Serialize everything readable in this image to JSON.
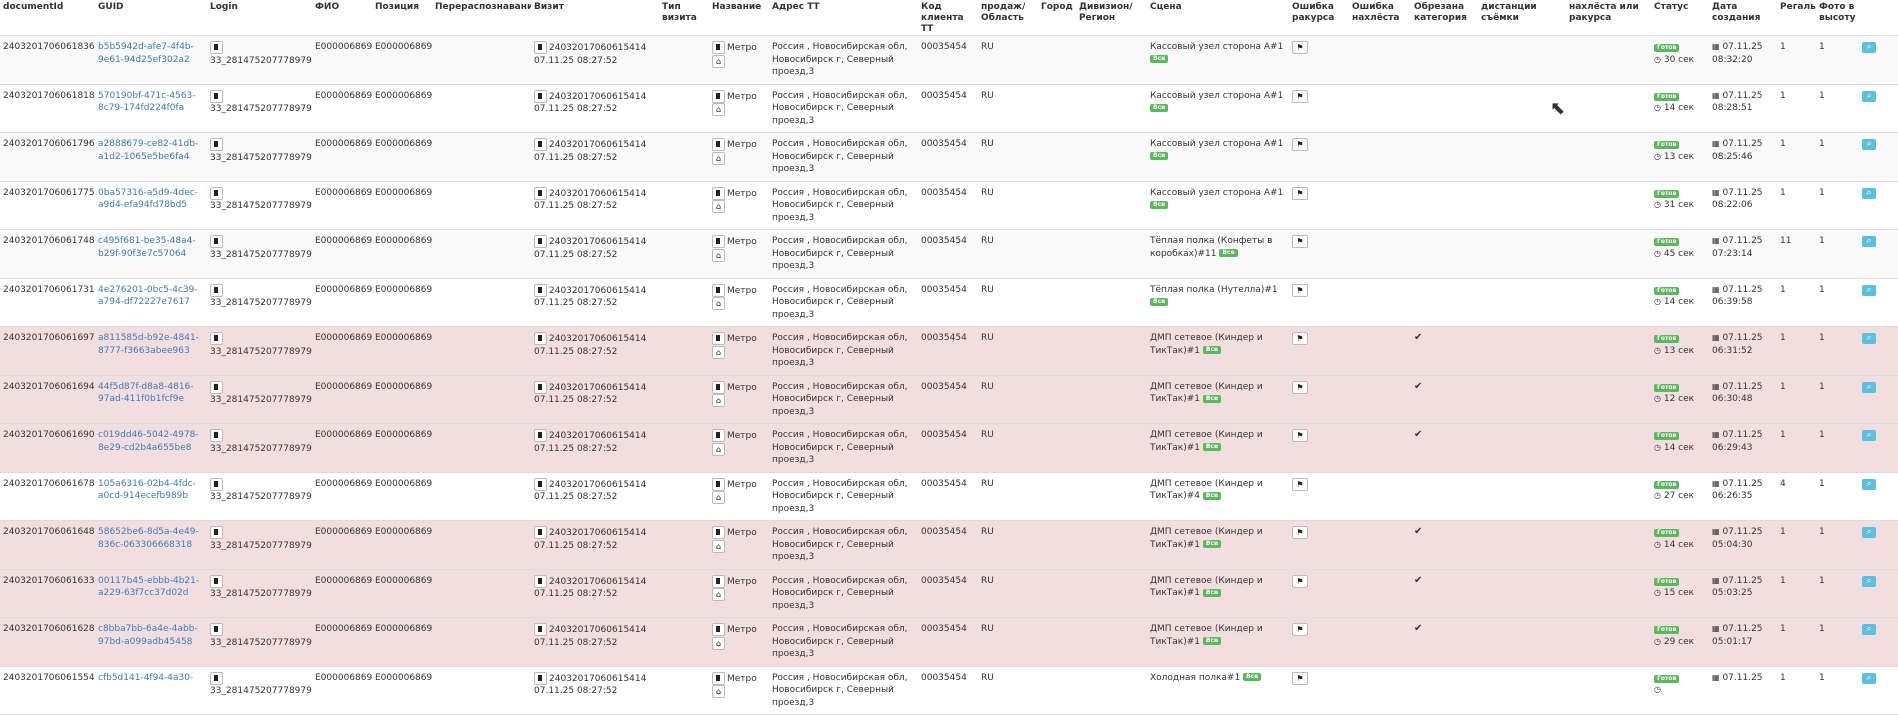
{
  "headers": {
    "documentId": "documentId",
    "guid": "GUID",
    "login": "Login",
    "fio": "ФИО",
    "position": "Позиция",
    "recognition": "Перераспознавание",
    "visit": "Визит",
    "visitType": "Тип визита",
    "name": "Название",
    "address": "Адрес ТТ",
    "clientCode": "Код клиента ТТ",
    "sales": "продаж/ Область",
    "city": "Город",
    "division": "Дивизион/ Регион",
    "scene": "Сцена",
    "angleError": "Ошибка ракурса",
    "overlapError": "Ошибка нахлёста",
    "categoryCut": "Обрезана категория",
    "distance": "дистанции съёмки",
    "overlapAngle": "нахлёста или ракурса",
    "status": "Статус",
    "created": "Дата создания",
    "shelves": "Регалы",
    "heightPhoto": "Фото в высоту"
  },
  "common": {
    "login": "33_281475207778979",
    "fio": "E000006869",
    "position": "E000006869",
    "visit_id": "24032017060615414",
    "visit_time": "07.11.25 08:27:52",
    "name": "Метро",
    "address": "Россия , Новосибирская обл, Новосибирск г, Северный проезд,3",
    "client_code": "00035454",
    "region": "RU",
    "status_label": "Готов",
    "badge_label": "Все",
    "search_icon": "search-icon"
  },
  "rows": [
    {
      "doc": "24032017060618361",
      "guid": "b5b5942d-afe7-4f4b-9e61-94d25ef302a2",
      "scene": "Кассовый узел сторона А#1",
      "cut": "",
      "status_time": "30 сек",
      "date": "07.11.25",
      "time": "08:32:20",
      "shelves": "1",
      "photo": "1",
      "style": "odd"
    },
    {
      "doc": "24032017060618180",
      "guid": "570190bf-471c-4563-8c79-174fd224f0fa",
      "scene": "Кассовый узел сторона А#1",
      "cut": "",
      "status_time": "14 сек",
      "date": "07.11.25",
      "time": "08:28:51",
      "shelves": "1",
      "photo": "1",
      "style": "even"
    },
    {
      "doc": "24032017060617969",
      "guid": "a2888679-ce82-41db-a1d2-1065e5be6fa4",
      "scene": "Кассовый узел сторона А#1",
      "cut": "",
      "status_time": "13 сек",
      "date": "07.11.25",
      "time": "08:25:46",
      "shelves": "1",
      "photo": "1",
      "style": "odd"
    },
    {
      "doc": "24032017060617755",
      "guid": "0ba57316-a5d9-4dec-a9d4-efa94fd78bd5",
      "scene": "Кассовый узел сторона А#1",
      "cut": "",
      "status_time": "31 сек",
      "date": "07.11.25",
      "time": "08:22:06",
      "shelves": "1",
      "photo": "1",
      "style": "even"
    },
    {
      "doc": "24032017060617489",
      "guid": "c495f681-be35-48a4-b29f-90f3e7c57064",
      "scene": "Тёплая полка (Конфеты в коробках)#11",
      "cut": "",
      "status_time": "45 сек",
      "date": "07.11.25",
      "time": "07:23:14",
      "shelves": "11",
      "photo": "1",
      "style": "odd"
    },
    {
      "doc": "24032017060617317",
      "guid": "4e276201-0bc5-4c39-a794-df72227e7617",
      "scene": "Тёплая полка (Нутелла)#1",
      "cut": "",
      "status_time": "14 сек",
      "date": "07.11.25",
      "time": "06:39:58",
      "shelves": "1",
      "photo": "1",
      "style": "even"
    },
    {
      "doc": "24032017060616977",
      "guid": "a811585d-b92e-4841-8777-f3663abee963",
      "scene": "ДМП сетевое (Киндер и ТикТак)#1",
      "cut": "✔",
      "status_time": "13 сек",
      "date": "07.11.25",
      "time": "06:31:52",
      "shelves": "1",
      "photo": "1",
      "style": "red"
    },
    {
      "doc": "24032017060616944",
      "guid": "44f5d87f-d8a8-4816-97ad-411f0b1fcf9e",
      "scene": "ДМП сетевое (Киндер и ТикТак)#1",
      "cut": "✔",
      "status_time": "12 сек",
      "date": "07.11.25",
      "time": "06:30:48",
      "shelves": "1",
      "photo": "1",
      "style": "red"
    },
    {
      "doc": "24032017060616907",
      "guid": "c019dd46-5042-4978-8e29-cd2b4a655be8",
      "scene": "ДМП сетевое (Киндер и ТикТак)#1",
      "cut": "✔",
      "status_time": "14 сек",
      "date": "07.11.25",
      "time": "06:29:43",
      "shelves": "1",
      "photo": "1",
      "style": "red"
    },
    {
      "doc": "24032017060616782",
      "guid": "105a6316-02b4-4fdc-a0cd-914ecefb989b",
      "scene": "ДМП сетевое (Киндер и ТикТак)#4",
      "cut": "",
      "status_time": "27 сек",
      "date": "07.11.25",
      "time": "06:26:35",
      "shelves": "4",
      "photo": "1",
      "style": "even"
    },
    {
      "doc": "24032017060616480",
      "guid": "58652be6-8d5a-4e49-836c-063306668318",
      "scene": "ДМП сетевое (Киндер и ТикТак)#1",
      "cut": "✔",
      "status_time": "14 сек",
      "date": "07.11.25",
      "time": "05:04:30",
      "shelves": "1",
      "photo": "1",
      "style": "red"
    },
    {
      "doc": "24032017060616332",
      "guid": "00117b45-ebbb-4b21-a229-63f7cc37d02d",
      "scene": "ДМП сетевое (Киндер и ТикТак)#1",
      "cut": "✔",
      "status_time": "15 сек",
      "date": "07.11.25",
      "time": "05:03:25",
      "shelves": "1",
      "photo": "1",
      "style": "red"
    },
    {
      "doc": "24032017060616287",
      "guid": "c8bba7bb-6a4e-4abb-97bd-a099adb45458",
      "scene": "ДМП сетевое (Киндер и ТикТак)#1",
      "cut": "✔",
      "status_time": "29 сек",
      "date": "07.11.25",
      "time": "05:01:17",
      "shelves": "1",
      "photo": "1",
      "style": "red"
    },
    {
      "doc": "24032017060615549",
      "guid": "cfb5d141-4f94-4a30-",
      "scene": "Холодная полка#1",
      "cut": "",
      "status_time": "",
      "date": "07.11.25",
      "time": "",
      "shelves": "1",
      "photo": "1",
      "style": "even"
    }
  ]
}
